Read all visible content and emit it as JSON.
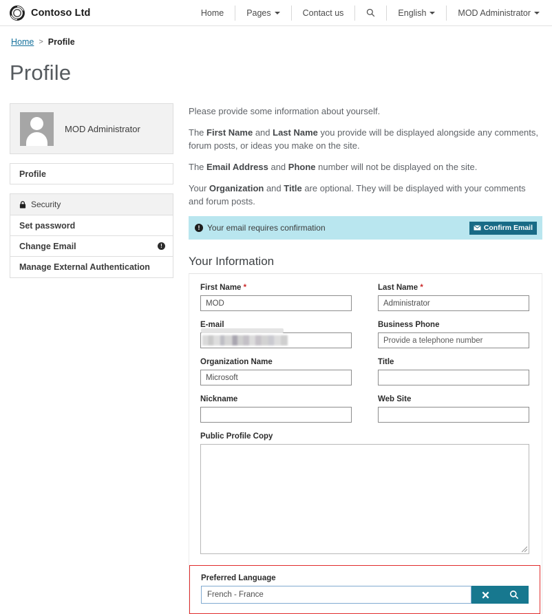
{
  "header": {
    "brand": "Contoso Ltd",
    "brand_logo_icon": "contoso-ring-logo",
    "nav": [
      {
        "label": "Home",
        "icon": null,
        "caret": false
      },
      {
        "label": "Pages",
        "icon": null,
        "caret": true
      },
      {
        "label": "Contact us",
        "icon": null,
        "caret": false
      },
      {
        "label": "",
        "icon": "search-icon",
        "caret": false
      },
      {
        "label": "English",
        "icon": null,
        "caret": true
      },
      {
        "label": "MOD Administrator",
        "icon": null,
        "caret": true
      }
    ]
  },
  "breadcrumb": {
    "home": "Home",
    "separator": ">",
    "current": "Profile"
  },
  "page": {
    "title": "Profile"
  },
  "sidebar": {
    "user": {
      "name": "MOD Administrator",
      "avatar_icon": "person-avatar-icon"
    },
    "profile_link": "Profile",
    "security": {
      "heading": "Security",
      "icon": "lock-icon",
      "items": [
        {
          "label": "Set password",
          "badge": null
        },
        {
          "label": "Change Email",
          "badge": "!"
        },
        {
          "label": "Manage External Authentication",
          "badge": null
        }
      ]
    }
  },
  "main": {
    "intro": [
      "Please provide some information about yourself.",
      "The First Name and Last Name you provide will be displayed alongside any comments, forum posts, or ideas you make on the site.",
      "The Email Address and Phone number will not be displayed on the site.",
      "Your Organization and Title are optional. They will be displayed with your comments and forum posts."
    ],
    "intro_parts": {
      "p1": "Please provide some information about yourself.",
      "p2a": "The ",
      "p2b": "First Name",
      "p2c": " and ",
      "p2d": "Last Name",
      "p2e": " you provide will be displayed alongside any comments, forum posts, or ideas you make on the site.",
      "p3a": "The ",
      "p3b": "Email Address",
      "p3c": " and ",
      "p3d": "Phone",
      "p3e": " number will not be displayed on the site.",
      "p4a": "Your ",
      "p4b": "Organization",
      "p4c": " and ",
      "p4d": "Title",
      "p4e": " are optional. They will be displayed with your comments and forum posts."
    },
    "alert": {
      "icon": "exclamation-circle-icon",
      "text": "Your email requires confirmation",
      "button_label": "Confirm Email",
      "button_icon": "envelope-icon",
      "background_color": "#b9e6ef",
      "button_color": "#186b86"
    },
    "section_title": "Your Information",
    "fields": {
      "first_name": {
        "label": "First Name",
        "required": "*",
        "value": "MOD",
        "placeholder": ""
      },
      "last_name": {
        "label": "Last Name",
        "required": "*",
        "value": "Administrator",
        "placeholder": ""
      },
      "email": {
        "label": "E-mail",
        "required": "",
        "value": "",
        "placeholder": "",
        "redacted": true
      },
      "business_phone": {
        "label": "Business Phone",
        "required": "",
        "value": "",
        "placeholder": "Provide a telephone number"
      },
      "organization": {
        "label": "Organization Name",
        "required": "",
        "value": "Microsoft",
        "placeholder": ""
      },
      "title": {
        "label": "Title",
        "required": "",
        "value": "",
        "placeholder": ""
      },
      "nickname": {
        "label": "Nickname",
        "required": "",
        "value": "",
        "placeholder": ""
      },
      "website": {
        "label": "Web Site",
        "required": "",
        "value": "",
        "placeholder": ""
      },
      "public_profile_copy": {
        "label": "Public Profile Copy",
        "value": "",
        "placeholder": ""
      },
      "preferred_language": {
        "label": "Preferred Language",
        "value": "French - France",
        "placeholder": "",
        "clear_icon": "close-x-icon",
        "search_icon": "search-icon",
        "highlight_color": "#e02b2b",
        "button_color": "#17788f"
      }
    }
  }
}
